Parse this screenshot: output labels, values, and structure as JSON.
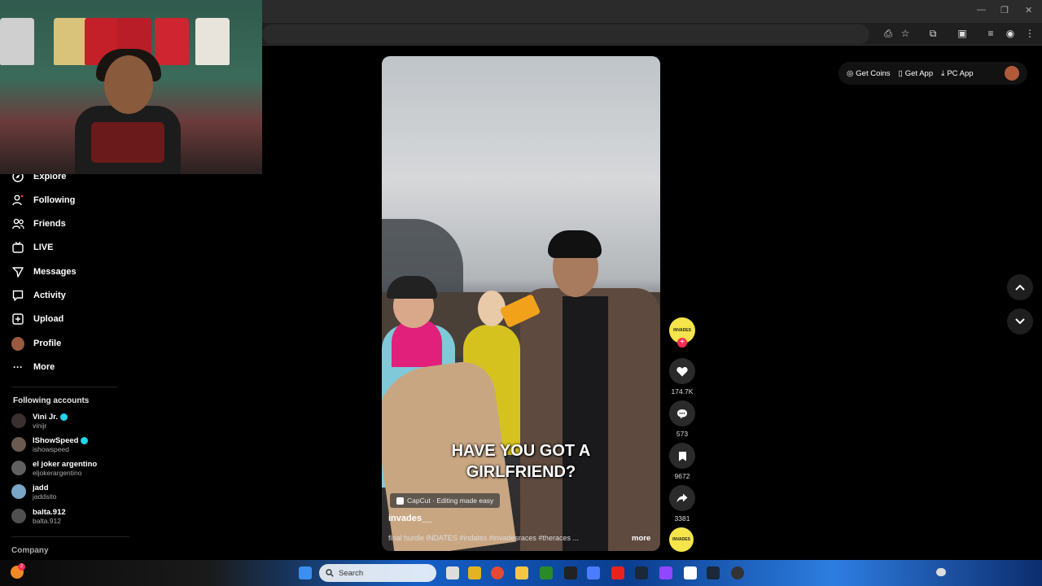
{
  "sidebar": {
    "nav": [
      {
        "label": "Explore",
        "icon": "compass-icon"
      },
      {
        "label": "Following",
        "icon": "following-icon"
      },
      {
        "label": "Friends",
        "icon": "friends-icon"
      },
      {
        "label": "LIVE",
        "icon": "live-icon"
      },
      {
        "label": "Messages",
        "icon": "messages-icon"
      },
      {
        "label": "Activity",
        "icon": "activity-icon"
      },
      {
        "label": "Upload",
        "icon": "upload-icon"
      },
      {
        "label": "Profile",
        "icon": "profile-avatar"
      },
      {
        "label": "More",
        "icon": "more-icon"
      }
    ],
    "following_title": "Following accounts",
    "accounts": [
      {
        "name": "Vini Jr.",
        "handle": "vinijr",
        "verified": true
      },
      {
        "name": "IShowSpeed",
        "handle": "ishowspeed",
        "verified": true
      },
      {
        "name": "el joker argentino",
        "handle": "eljokerargentino",
        "verified": false
      },
      {
        "name": "jadd",
        "handle": "jaddsito",
        "verified": false
      },
      {
        "name": "balta.912",
        "handle": "balta.912",
        "verified": false
      }
    ],
    "company_label": "Company"
  },
  "topbar": {
    "get_coins": "Get Coins",
    "get_app": "Get App",
    "pc_app": "PC App"
  },
  "video": {
    "caption": "HAVE YOU GOT A GIRLFRIEND?",
    "capcut": "CapCut · Editing made easy",
    "username": "invades__",
    "description": "final hurdle INDATES #indates #invadesraces #theraces ...",
    "more": "more",
    "avatar_text": "INVADES"
  },
  "actions": {
    "likes": "174.7K",
    "comments": "573",
    "saves": "9672",
    "shares": "3381"
  },
  "taskbar": {
    "search_placeholder": "Search",
    "notification_count": "2"
  },
  "colors": {
    "accent": "#fe2c55",
    "verified": "#20d5ec",
    "avatar_yellow": "#f5e54a"
  }
}
